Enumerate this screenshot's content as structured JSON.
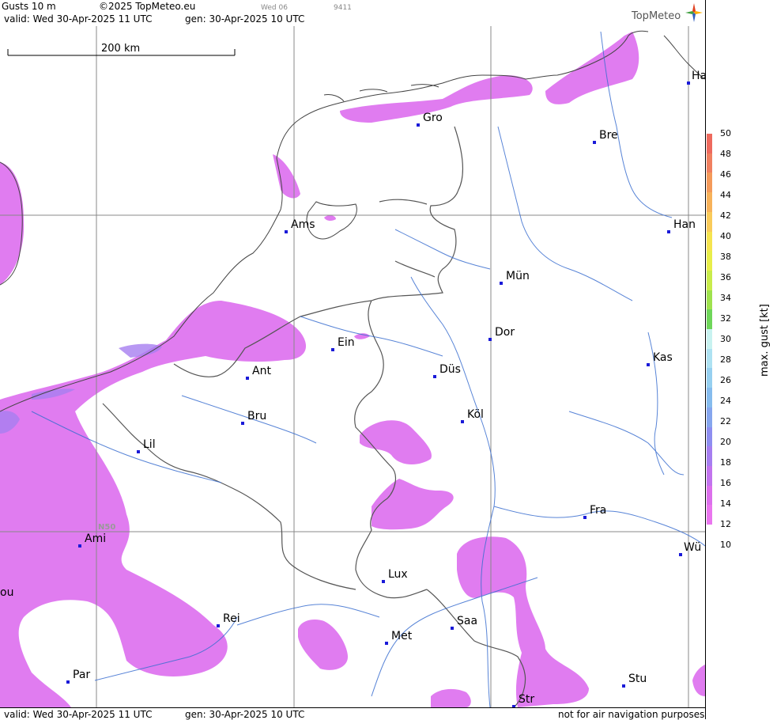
{
  "header": {
    "title": "Gusts 10 m",
    "copyright": "©2025 TopMeteo.eu",
    "small_day": "Wed 06",
    "small_code": "9411",
    "valid": "valid:  Wed  30-Apr-2025  11 UTC",
    "gen": "gen: 30-Apr-2025 10 UTC",
    "logo_text": "TopMeteo"
  },
  "footer": {
    "valid": "valid:  Wed  30-Apr-2025  11 UTC",
    "gen": "gen: 30-Apr-2025 10 UTC",
    "note": "not for air navigation purposes"
  },
  "map": {
    "scale_label": "200 km",
    "lat_label": "N50",
    "cities": [
      {
        "name": "Ha"
      },
      {
        "name": "Gro"
      },
      {
        "name": "Bre"
      },
      {
        "name": "Ams"
      },
      {
        "name": "Han"
      },
      {
        "name": "Mün"
      },
      {
        "name": "Ein"
      },
      {
        "name": "Dor"
      },
      {
        "name": "Ant"
      },
      {
        "name": "Düs"
      },
      {
        "name": "Kas"
      },
      {
        "name": "Bru"
      },
      {
        "name": "Köl"
      },
      {
        "name": "Lil"
      },
      {
        "name": "Fra"
      },
      {
        "name": "Ami"
      },
      {
        "name": "Wü"
      },
      {
        "name": "Lux"
      },
      {
        "name": "ou"
      },
      {
        "name": "Rei"
      },
      {
        "name": "Saa"
      },
      {
        "name": "Met"
      },
      {
        "name": "Par"
      },
      {
        "name": "Stu"
      },
      {
        "name": "Str"
      }
    ]
  },
  "legend": {
    "title": "max. gust [kt]",
    "ticks": [
      "50",
      "48",
      "46",
      "44",
      "42",
      "40",
      "38",
      "36",
      "34",
      "32",
      "30",
      "28",
      "26",
      "24",
      "22",
      "20",
      "18",
      "16",
      "14",
      "12",
      "10"
    ],
    "colors": [
      "#ee6a5e",
      "#f08060",
      "#f49a5a",
      "#f7b25a",
      "#f9cb5a",
      "#f5e450",
      "#e8ee4a",
      "#c9ec4c",
      "#9fe24e",
      "#6fd65a",
      "#c8f2f0",
      "#aee2f2",
      "#96d0f0",
      "#86bcee",
      "#86a6ee",
      "#8e8ef0",
      "#a67ef0",
      "#c274ee",
      "#dc70ec",
      "#ea76ef"
    ],
    "wind_color": "#e07cf0"
  }
}
